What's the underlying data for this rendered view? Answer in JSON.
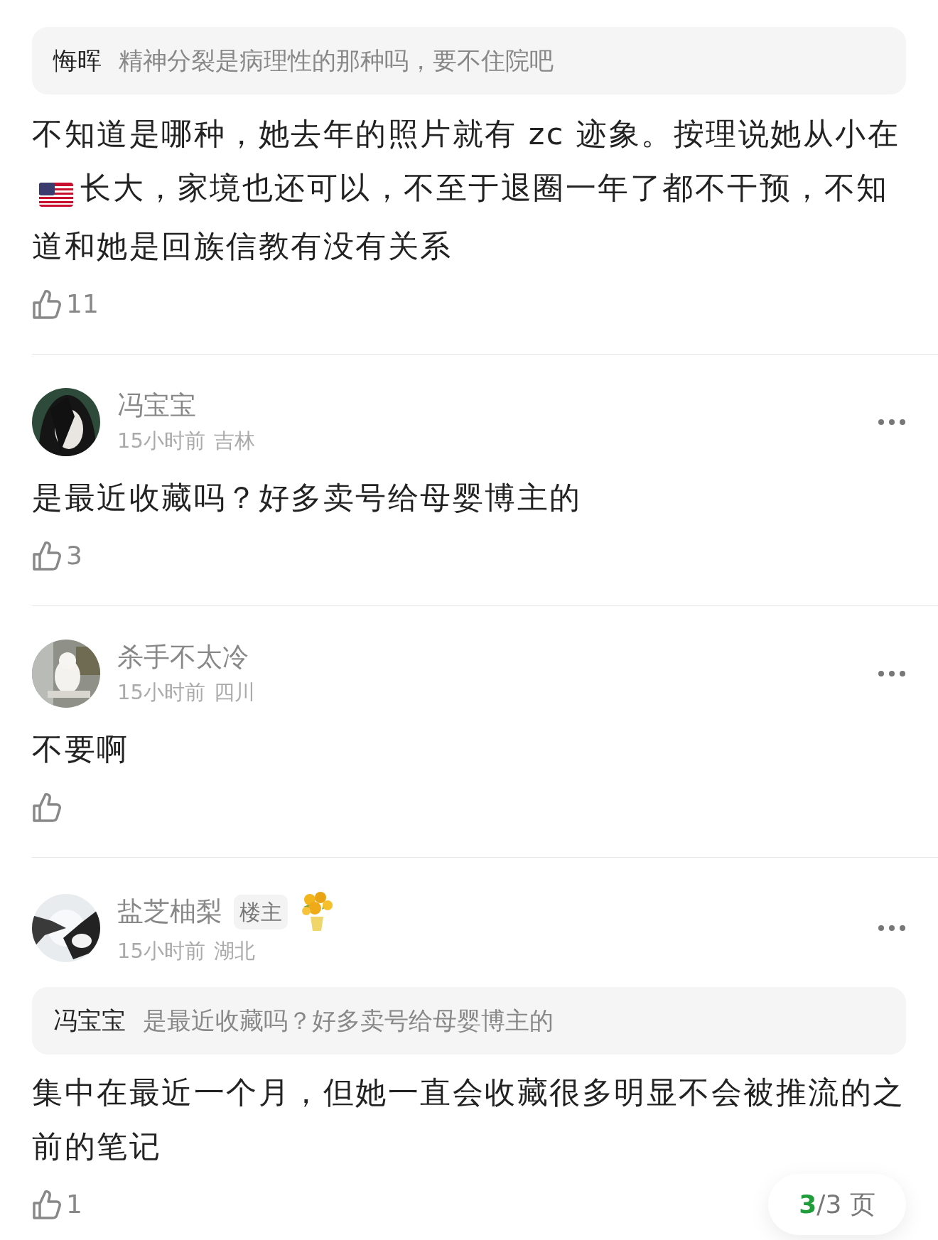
{
  "comments": [
    {
      "quote": {
        "author": "悔晖",
        "text": "精神分裂是病理性的那种吗，要不住院吧"
      },
      "body": [
        {
          "kind": "text",
          "text": "不知道是哪种，她去年的照片就有 zc 迹象。按理说她从小在"
        },
        {
          "kind": "flag"
        },
        {
          "kind": "text",
          "text": "长大，家境也还可以，不至于退圈一年了都不干预，不知道和她是回族信教有没有关系"
        }
      ],
      "likes": "11"
    },
    {
      "author": "冯宝宝",
      "time": "15小时前",
      "location": "吉林",
      "body": [
        {
          "kind": "text",
          "text": "是最近收藏吗？好多卖号给母婴博主的"
        }
      ],
      "likes": "3"
    },
    {
      "author": "杀手不太冷",
      "time": "15小时前",
      "location": "四川",
      "body": [
        {
          "kind": "text",
          "text": "不要啊"
        }
      ]
    },
    {
      "author": "盐芝柚梨",
      "badge": "楼主",
      "time": "15小时前",
      "location": "湖北",
      "quote": {
        "author": "冯宝宝",
        "text": "是最近收藏吗？好多卖号给母婴博主的"
      },
      "body": [
        {
          "kind": "text",
          "text": "集中在最近一个月，但她一直会收藏很多明显不会被推流的之前的笔记"
        }
      ],
      "likes": "1"
    }
  ],
  "pager": {
    "current": "3",
    "rest": "/3 页"
  }
}
